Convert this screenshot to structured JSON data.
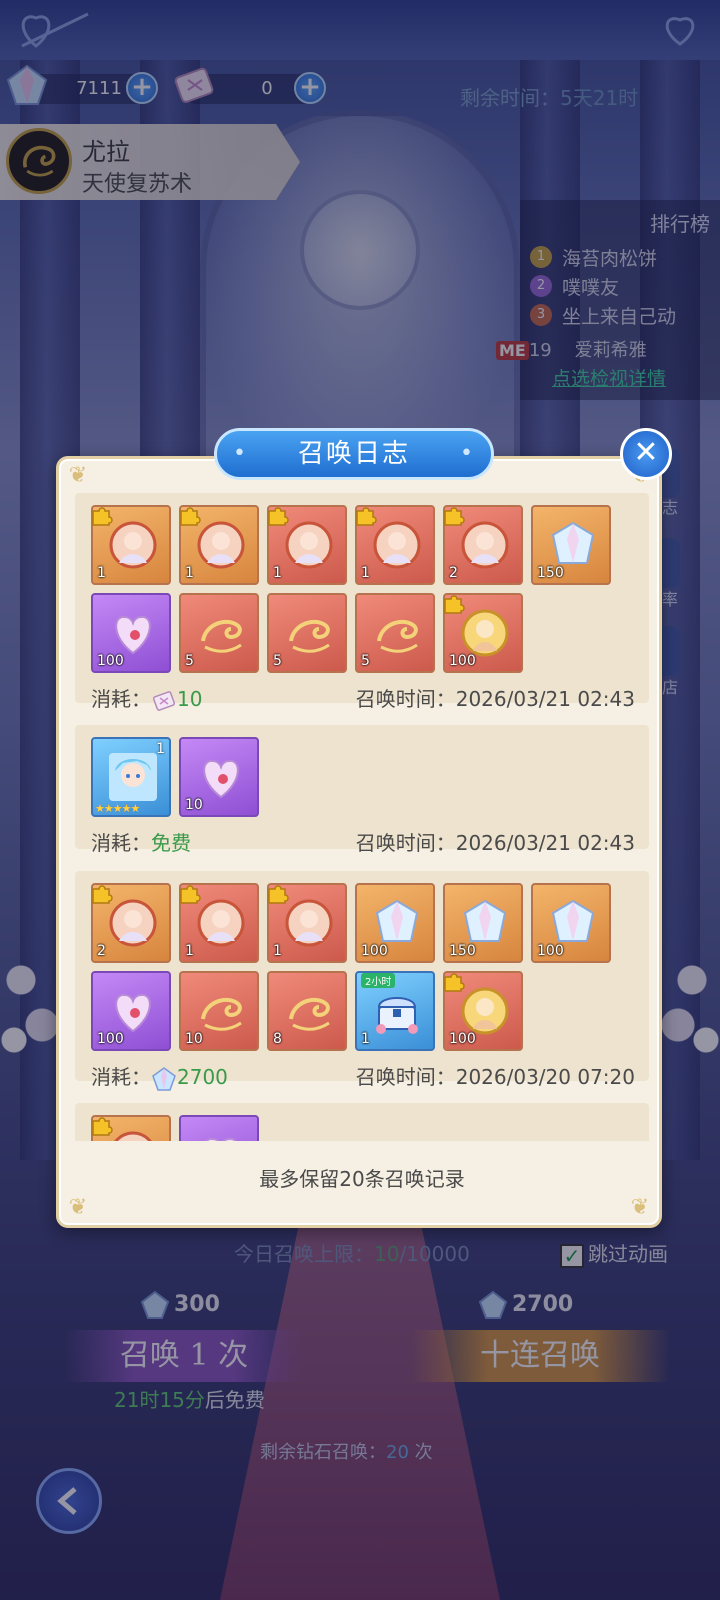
{
  "currencies": [
    {
      "name": "diamond",
      "value": "7111"
    },
    {
      "name": "summon-ticket",
      "value": "0"
    }
  ],
  "remaining_time": {
    "label": "剩余时间：",
    "value": "5天21时"
  },
  "character": {
    "name": "尤拉",
    "skill": "天使复苏术"
  },
  "ranking": {
    "title": "排行榜",
    "entries": [
      {
        "rank": "1",
        "name": "海苔肉松饼",
        "color": "#c9a441"
      },
      {
        "rank": "2",
        "name": "噗噗友",
        "color": "#9a6ad8"
      },
      {
        "rank": "3",
        "name": "坐上来自己动",
        "color": "#c86a4a"
      }
    ],
    "me_label": "ME",
    "me_rank": "19",
    "me_name": "爱莉希雅",
    "detail_link": "点选检视详情"
  },
  "side_buttons": [
    {
      "label": "日志",
      "icon": "log-icon"
    },
    {
      "label": "概率",
      "icon": "probability-icon"
    },
    {
      "label": "商店",
      "icon": "shop-icon"
    }
  ],
  "modal": {
    "title": "召唤日志",
    "footer": "最多保留20条召唤记录",
    "cost_label": "消耗：",
    "time_label": "召唤时间：",
    "records": [
      {
        "cost_icon": "ticket-icon",
        "cost_value": "10",
        "time": "2026/03/21 02:43",
        "items": [
          {
            "type": "card-fragment",
            "color": "orange",
            "qty": "1"
          },
          {
            "type": "card-fragment",
            "color": "orange",
            "qty": "1"
          },
          {
            "type": "card-fragment",
            "color": "red",
            "qty": "1"
          },
          {
            "type": "card-fragment",
            "color": "red",
            "qty": "1"
          },
          {
            "type": "card-fragment",
            "color": "red",
            "qty": "2"
          },
          {
            "type": "crystal",
            "color": "orange",
            "qty": "150"
          },
          {
            "type": "heart-gem",
            "color": "purple",
            "qty": "100"
          },
          {
            "type": "dragon-emblem",
            "color": "red",
            "qty": "5"
          },
          {
            "type": "dragon-emblem",
            "color": "red",
            "qty": "5"
          },
          {
            "type": "dragon-emblem",
            "color": "red",
            "qty": "5"
          },
          {
            "type": "gold-medal-fragment",
            "color": "red",
            "qty": "100"
          }
        ]
      },
      {
        "cost_icon": "",
        "cost_value": "免费",
        "time": "2026/03/21 02:43",
        "items": [
          {
            "type": "character-card",
            "color": "blue",
            "qty": "1",
            "stars": "★★★★★"
          },
          {
            "type": "heart-gem",
            "color": "purple",
            "qty": "10"
          }
        ]
      },
      {
        "cost_icon": "diamond-icon",
        "cost_value": "2700",
        "time": "2026/03/20 07:20",
        "items": [
          {
            "type": "card-fragment",
            "color": "orange",
            "qty": "2"
          },
          {
            "type": "card-fragment",
            "color": "red",
            "qty": "1"
          },
          {
            "type": "card-fragment",
            "color": "red",
            "qty": "1"
          },
          {
            "type": "crystal",
            "color": "orange",
            "qty": "100"
          },
          {
            "type": "crystal",
            "color": "orange",
            "qty": "150"
          },
          {
            "type": "crystal",
            "color": "orange",
            "qty": "100"
          },
          {
            "type": "heart-gem",
            "color": "purple",
            "qty": "100"
          },
          {
            "type": "dragon-emblem",
            "color": "red",
            "qty": "10"
          },
          {
            "type": "dragon-emblem",
            "color": "red",
            "qty": "8"
          },
          {
            "type": "treasure-chest",
            "color": "blue",
            "qty": "1",
            "badge": "2小时"
          },
          {
            "type": "gold-medal-fragment",
            "color": "red",
            "qty": "100"
          }
        ]
      },
      {
        "cost_icon": "",
        "cost_value": "",
        "time": "",
        "items": [
          {
            "type": "card-fragment",
            "color": "orange",
            "qty": ""
          },
          {
            "type": "heart-gem",
            "color": "purple",
            "qty": ""
          }
        ]
      }
    ]
  },
  "bottom": {
    "limit_label": "今日召唤上限：",
    "limit_current": "10",
    "limit_max": "/10000",
    "skip_label": "跳过动画",
    "skip_checked": true,
    "single_cost": "300",
    "ten_cost": "2700",
    "single_label": "召唤 1 次",
    "ten_label": "十连召唤",
    "free_time": "21时15分",
    "free_suffix": "后免费",
    "remain_label": "剩余钻石召唤：",
    "remain_count": "20",
    "remain_unit": "次"
  }
}
